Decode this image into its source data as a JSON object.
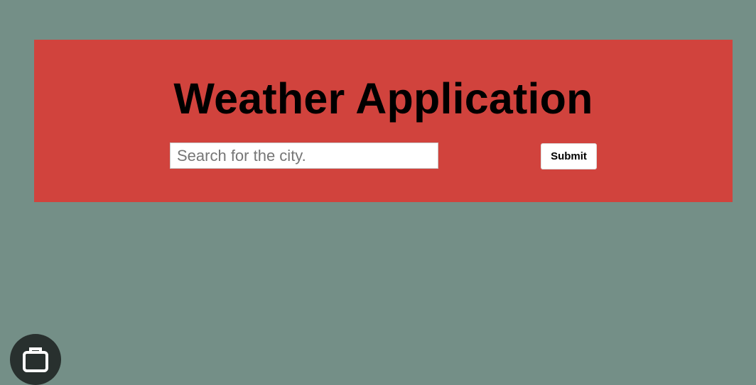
{
  "header": {
    "title": "Weather Application"
  },
  "search": {
    "placeholder": "Search for the city.",
    "value": "",
    "submit_label": "Submit"
  },
  "floating_button": {
    "icon": "briefcase-icon"
  },
  "colors": {
    "page_background": "#748f87",
    "panel_background": "#d1433d",
    "title_text": "#000000",
    "button_background": "#ffffff",
    "floating_button_background": "#28302e"
  }
}
